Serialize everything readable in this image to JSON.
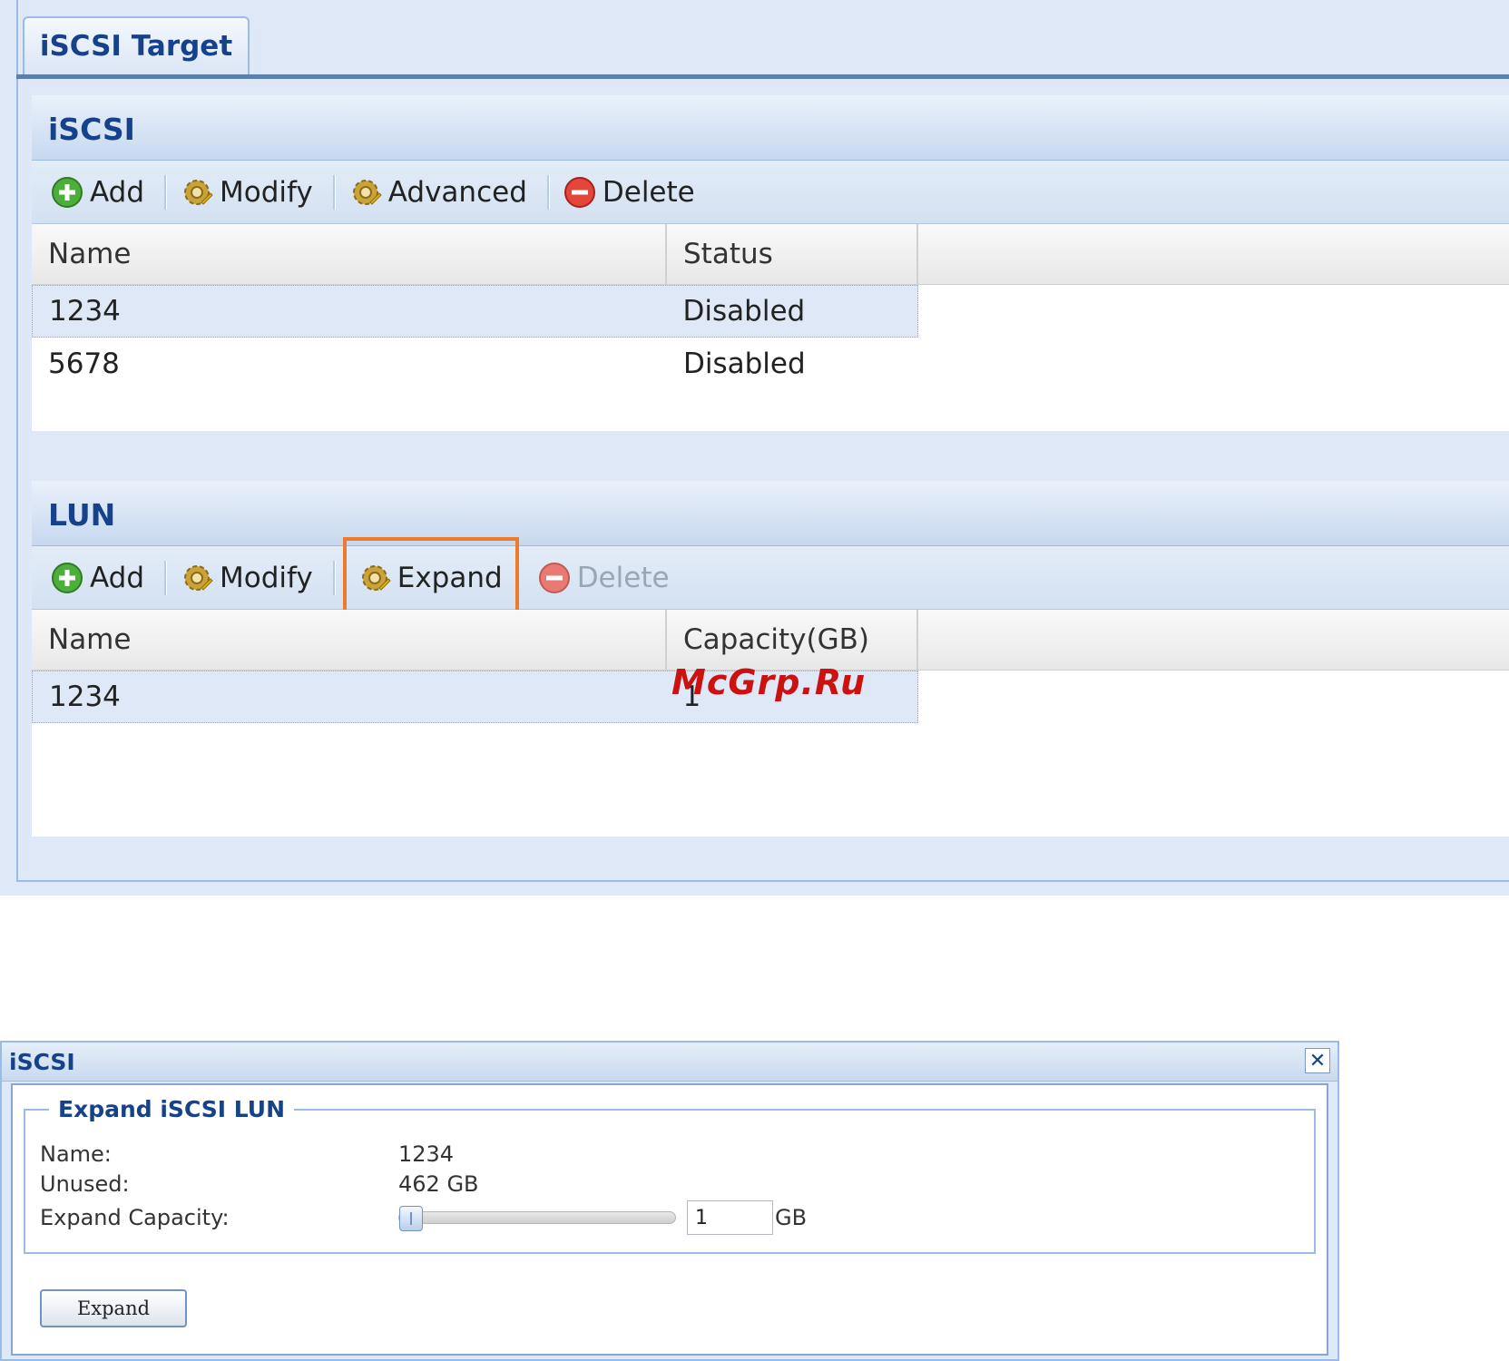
{
  "top": {
    "tab_label": "iSCSI Target",
    "iscsi_section": {
      "title": "iSCSI",
      "toolbar": {
        "add": "Add",
        "modify": "Modify",
        "advanced": "Advanced",
        "delete": "Delete"
      },
      "columns": [
        "Name",
        "Status"
      ],
      "rows": [
        {
          "name": "1234",
          "status": "Disabled"
        },
        {
          "name": "5678",
          "status": "Disabled"
        }
      ]
    },
    "lun_section": {
      "title": "LUN",
      "toolbar": {
        "add": "Add",
        "modify": "Modify",
        "expand": "Expand",
        "delete": "Delete"
      },
      "columns": [
        "Name",
        "Capacity(GB)"
      ],
      "rows": [
        {
          "name": "1234",
          "capacity": "1"
        }
      ]
    },
    "watermark": "McGrp.Ru"
  },
  "dialog": {
    "title": "iSCSI",
    "fieldset_title": "Expand iSCSI LUN",
    "name_label": "Name:",
    "name_value": "1234",
    "unused_label": "Unused:",
    "unused_value": "462 GB",
    "expand_capacity_label": "Expand Capacity:",
    "slider_fraction": 0.0,
    "capacity_value": "1",
    "capacity_unit": "GB",
    "expand_button": "Expand"
  },
  "colors": {
    "accent": "#15428b",
    "highlight": "#ee7a2c",
    "watermark": "#cc1111"
  },
  "icons": [
    "add-icon",
    "gear-icon",
    "delete-icon",
    "close-icon"
  ]
}
